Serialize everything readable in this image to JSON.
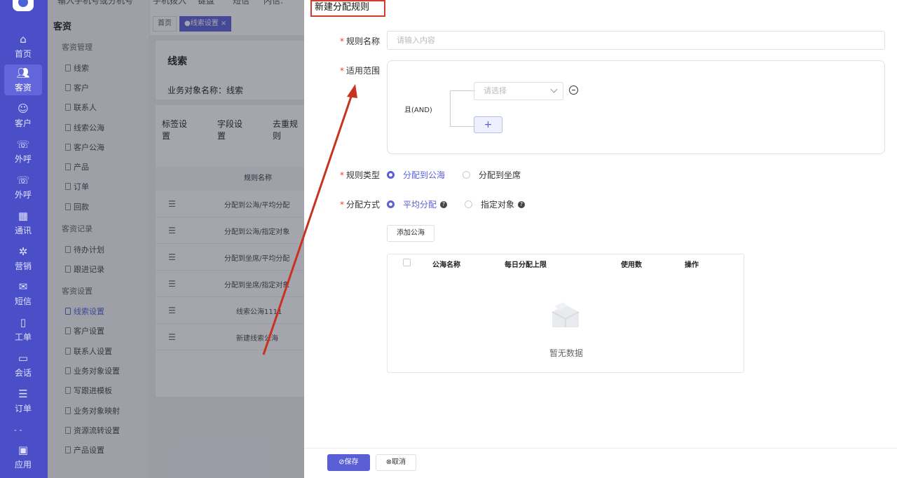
{
  "topbar": {
    "search_hint": "输入手机号或分机号",
    "items": [
      "手机拨入",
      "键盘",
      "短信",
      "内信:"
    ]
  },
  "nav": {
    "items": [
      {
        "label": "首页",
        "icon": "home-icon"
      },
      {
        "label": "客资",
        "icon": "users-icon",
        "active": true
      },
      {
        "label": "客户",
        "icon": "person-icon"
      },
      {
        "label": "外呼",
        "icon": "phone-out-icon"
      },
      {
        "label": "外呼",
        "icon": "phone-in-icon"
      },
      {
        "label": "通讯",
        "icon": "contacts-icon"
      },
      {
        "label": "营销",
        "icon": "gear-icon"
      },
      {
        "label": "短信",
        "icon": "mail-icon"
      },
      {
        "label": "工单",
        "icon": "clipboard-icon"
      },
      {
        "label": "会话",
        "icon": "chat-icon"
      },
      {
        "label": "订单",
        "icon": "order-icon"
      },
      {
        "label": "应用",
        "icon": "app-icon"
      }
    ]
  },
  "submenu": {
    "title": "客资",
    "groups": [
      {
        "title": "客资管理",
        "items": [
          "线索",
          "客户",
          "联系人",
          "线索公海",
          "客户公海",
          "产品",
          "订单",
          "回款"
        ]
      },
      {
        "title": "客资记录",
        "items": [
          "待办计划",
          "跟进记录"
        ]
      },
      {
        "title": "客资设置",
        "items": [
          "线索设置",
          "客户设置",
          "联系人设置",
          "业务对象设置",
          "写跟进模板",
          "业务对象映射",
          "资源流转设置",
          "产品设置"
        ]
      }
    ],
    "active": "线索设置"
  },
  "tabs": [
    {
      "label": "首页"
    },
    {
      "label": "●线索设置 ×",
      "active": true
    }
  ],
  "bg": {
    "title": "线索",
    "object_name": "业务对象名称：线索",
    "sub_tabs": [
      "标签设置",
      "字段设置",
      "去重规则"
    ],
    "table_header": "规则名称",
    "rows": [
      "分配到公海/平均分配",
      "分配到公海/指定对象",
      "分配到坐席/平均分配",
      "分配到坐席/指定对象",
      "线索公海1111",
      "新建线索公海"
    ]
  },
  "drawer": {
    "title": "新建分配规则",
    "rule_name_label": "规则名称",
    "rule_name_placeholder": "请输入内容",
    "scope_label": "适用范围",
    "and_label": "且(AND)",
    "select_placeholder": "请选择",
    "add_condition": "+",
    "rule_type_label": "规则类型",
    "rule_type_options": [
      "分配到公海",
      "分配到坐席"
    ],
    "method_label": "分配方式",
    "method_options": [
      "平均分配",
      "指定对象"
    ],
    "add_pool_button": "添加公海",
    "table_columns": [
      "公海名称",
      "每日分配上限",
      "使用数",
      "操作"
    ],
    "empty_text": "暂无数据",
    "save_button": "⊘保存",
    "cancel_button": "⊗取消"
  },
  "colors": {
    "primary": "#5b5fd6",
    "nav": "#4a4fc7",
    "required": "#e0443b",
    "annotation": "#d23c2a"
  }
}
